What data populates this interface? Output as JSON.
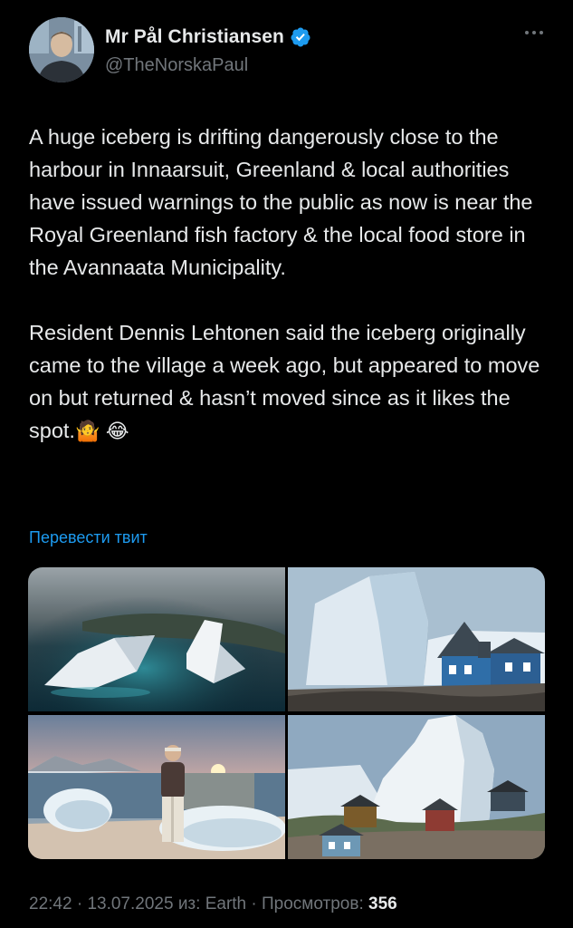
{
  "author": {
    "display_name": "Mr Pål Christiansen",
    "handle": "@TheNorskaPaul",
    "verified": true,
    "avatar_icon": "avatar-photo",
    "verified_color": "#1d9bf0"
  },
  "tweet": {
    "paragraphs": [
      "A huge iceberg is drifting dangerously close to the harbour in Innaarsuit, Greenland & local authorities have issued warnings to the public as now is near the Royal Greenland fish factory & the local food store in the Avannaata Municipality.",
      "Resident Dennis Lehtonen said the iceberg originally came to the village a week ago, but appeared to move on but returned & hasn’t moved since as it likes the spot."
    ],
    "emoji_1": "🤷",
    "emoji_2": "😂",
    "translate_label": "Перевести твит"
  },
  "media": [
    {
      "icon": "aerial-icebergs-photo"
    },
    {
      "icon": "iceberg-blue-house-photo"
    },
    {
      "icon": "man-iceberg-sunset-photo"
    },
    {
      "icon": "iceberg-village-houses-photo"
    }
  ],
  "meta": {
    "time": "22:42",
    "date": "13.07.2025",
    "source_prefix": "из:",
    "source": "Earth",
    "views_label": "Просмотров:",
    "views": "356"
  },
  "colors": {
    "background": "#000000",
    "text": "#e7e9ea",
    "secondary": "#71767b",
    "link": "#1d9bf0"
  }
}
